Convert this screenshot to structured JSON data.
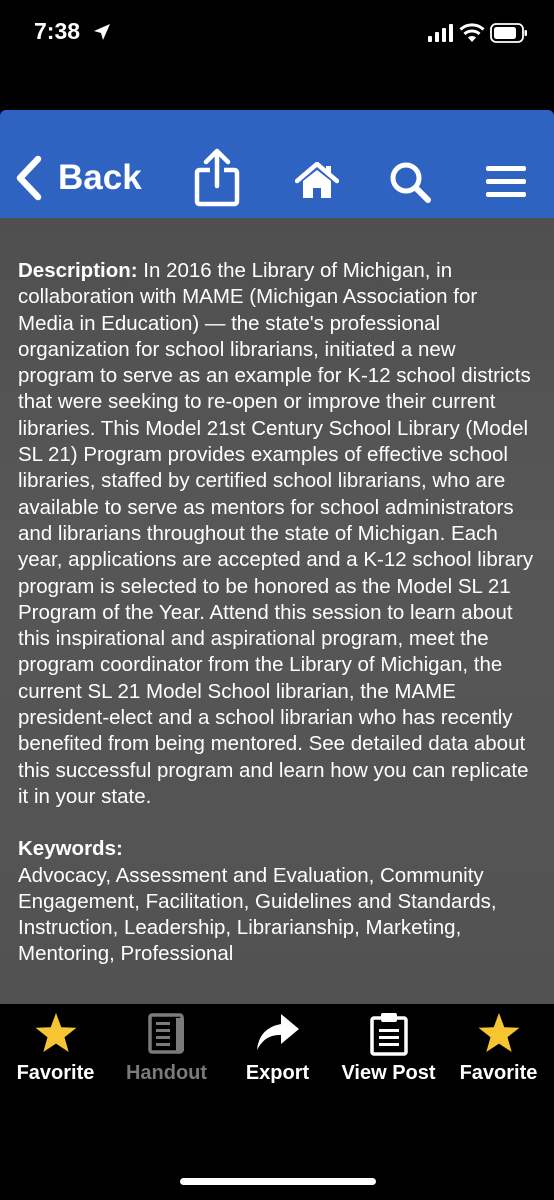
{
  "status_bar": {
    "time": "7:38"
  },
  "nav": {
    "back_label": "Back",
    "icons": [
      "share-icon",
      "home-icon",
      "search-icon",
      "menu-icon"
    ],
    "color": "#2e63c2"
  },
  "content": {
    "description_label": "Description:",
    "description_text": " In 2016 the Library of Michigan, in collaboration with MAME (Michigan Association for Media in Education) — the state's professional organization for school librarians, initiated a new program to serve as an example for K-12 school districts that were seeking to re-open or improve their current libraries. This Model 21st Century School Library (Model SL 21) Program provides examples of effective school libraries, staffed by certified school librarians, who are available to serve as mentors for school administrators and librarians throughout the state of Michigan. Each year, applications are accepted and a K-12 school library program is selected to be honored as the Model SL 21 Program of the Year. Attend this session to learn about this inspirational and aspirational program, meet the program coordinator from the Library of Michigan, the current SL 21 Model School librarian, the MAME president-elect and a school librarian who has recently benefited from being mentored. See detailed data about this successful program and learn how you can replicate it in your state.",
    "keywords_label": "Keywords:",
    "keywords_text": "Advocacy, Assessment and Evaluation, Community Engagement, Facilitation, Guidelines and Standards, Instruction, Leadership, Librarianship, Marketing, Mentoring, Professional"
  },
  "tab_bar": {
    "items": [
      {
        "label": "Favorite",
        "icon": "star-icon",
        "enabled": true
      },
      {
        "label": "Handout",
        "icon": "handout-icon",
        "enabled": false
      },
      {
        "label": "Export",
        "icon": "export-arrow-icon",
        "enabled": true
      },
      {
        "label": "View Post",
        "icon": "clipboard-icon",
        "enabled": true
      },
      {
        "label": "Favorite",
        "icon": "star-icon",
        "enabled": true
      }
    ],
    "star_color": "#f7c531"
  }
}
